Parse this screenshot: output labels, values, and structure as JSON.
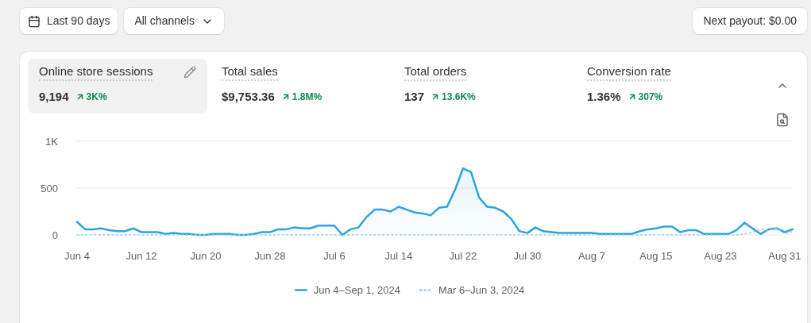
{
  "toolbar": {
    "date_range": "Last 90 days",
    "channel_filter": "All channels",
    "payout": "Next payout: $0.00"
  },
  "metrics": [
    {
      "label": "Online store sessions",
      "value": "9,194",
      "change": "3K%",
      "selected": true
    },
    {
      "label": "Total sales",
      "value": "$9,753.36",
      "change": "1.8M%",
      "selected": false
    },
    {
      "label": "Total orders",
      "value": "137",
      "change": "13.6K%",
      "selected": false
    },
    {
      "label": "Conversion rate",
      "value": "1.36%",
      "change": "307%",
      "selected": false
    }
  ],
  "chart_data": {
    "type": "area",
    "categories": [
      "Jun 4",
      null,
      null,
      null,
      null,
      null,
      null,
      null,
      "Jun 12",
      null,
      null,
      null,
      null,
      null,
      null,
      null,
      "Jun 20",
      null,
      null,
      null,
      null,
      null,
      null,
      null,
      "Jun 28",
      null,
      null,
      null,
      null,
      null,
      null,
      null,
      "Jul 6",
      null,
      null,
      null,
      null,
      null,
      null,
      null,
      "Jul 14",
      null,
      null,
      null,
      null,
      null,
      null,
      null,
      "Jul 22",
      null,
      null,
      null,
      null,
      null,
      null,
      null,
      "Jul 30",
      null,
      null,
      null,
      null,
      null,
      null,
      null,
      "Aug 7",
      null,
      null,
      null,
      null,
      null,
      null,
      null,
      "Aug 15",
      null,
      null,
      null,
      null,
      null,
      null,
      null,
      "Aug 23",
      null,
      null,
      null,
      null,
      null,
      null,
      null,
      "Aug 31",
      null
    ],
    "series": [
      {
        "name": "Jun 4–Sep 1, 2024",
        "type": "area",
        "line_style": "solid",
        "color": "#2ea3dc",
        "values": [
          140,
          60,
          60,
          70,
          50,
          40,
          40,
          70,
          30,
          30,
          30,
          10,
          20,
          10,
          10,
          0,
          0,
          10,
          10,
          10,
          0,
          0,
          10,
          30,
          30,
          60,
          60,
          80,
          70,
          70,
          100,
          100,
          100,
          0,
          60,
          80,
          190,
          270,
          270,
          250,
          300,
          270,
          240,
          230,
          210,
          290,
          300,
          480,
          710,
          670,
          400,
          300,
          290,
          250,
          170,
          40,
          20,
          80,
          40,
          30,
          20,
          20,
          20,
          20,
          20,
          10,
          10,
          10,
          10,
          10,
          40,
          60,
          70,
          90,
          90,
          30,
          50,
          50,
          10,
          10,
          10,
          10,
          50,
          130,
          70,
          10,
          60,
          70,
          30,
          60
        ]
      },
      {
        "name": "Mar 6–Jun 3, 2024",
        "type": "line",
        "line_style": "dotted",
        "color": "#8fd0ec",
        "values": [
          0,
          0,
          0,
          0,
          0,
          0,
          0,
          0,
          0,
          0,
          0,
          0,
          0,
          0,
          0,
          0,
          0,
          0,
          0,
          0,
          0,
          0,
          0,
          0,
          0,
          0,
          0,
          0,
          0,
          0,
          0,
          0,
          0,
          0,
          0,
          0,
          0,
          0,
          0,
          0,
          0,
          0,
          0,
          0,
          0,
          0,
          0,
          0,
          0,
          0,
          0,
          0,
          0,
          0,
          0,
          0,
          0,
          0,
          0,
          0,
          0,
          0,
          0,
          0,
          0,
          0,
          0,
          0,
          0,
          0,
          0,
          0,
          0,
          0,
          0,
          0,
          0,
          0,
          0,
          0,
          0,
          0,
          0,
          10,
          30,
          60,
          50,
          70,
          10,
          40
        ]
      }
    ],
    "legend": "bottom",
    "ylim": [
      0,
      1000
    ],
    "yticks": [
      {
        "value": 0,
        "label": "0"
      },
      {
        "value": 500,
        "label": "500"
      },
      {
        "value": 1000,
        "label": "1K"
      }
    ]
  }
}
